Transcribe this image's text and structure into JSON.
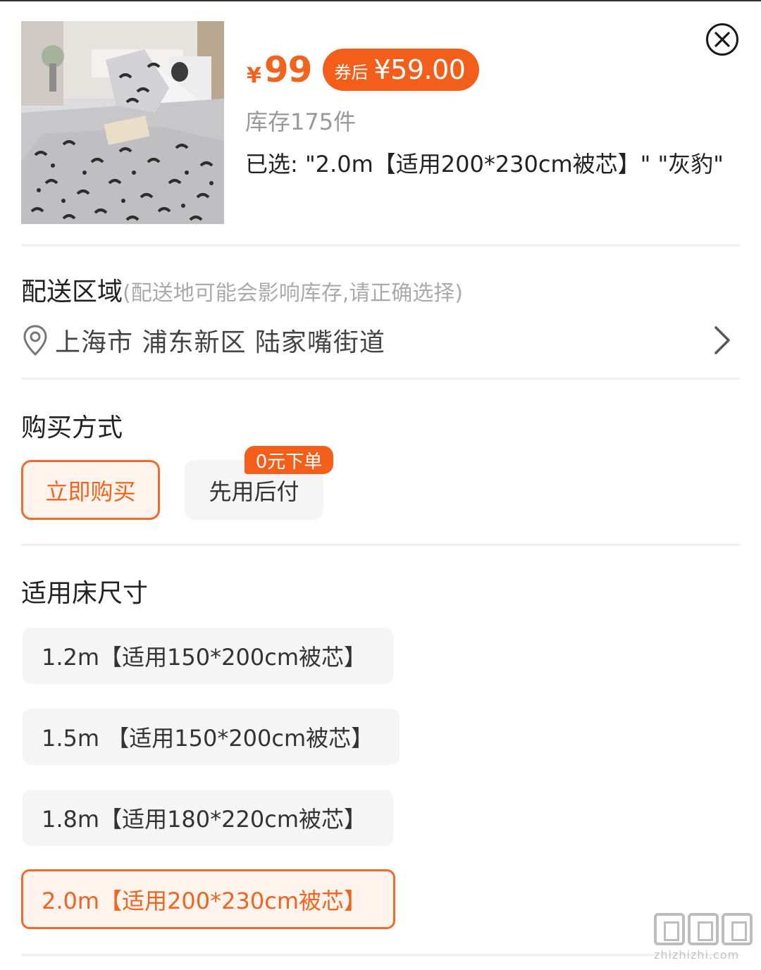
{
  "product": {
    "image_icon": "bedding-leopard-print-photo",
    "currency_symbol": "¥",
    "price": "99",
    "coupon_label": "券后",
    "coupon_price": "¥59.00",
    "stock": "库存175件",
    "selected_text": "已选: \"2.0m【适用200*230cm被芯】\" \"灰豹\""
  },
  "close_icon": "close-circle-icon",
  "delivery": {
    "title": "配送区域",
    "hint": "(配送地可能会影响库存,请正确选择)",
    "address": "上海市 浦东新区 陆家嘴街道"
  },
  "purchase": {
    "title": "购买方式",
    "buy_now": "立即购买",
    "pay_later": "先用后付",
    "pay_later_badge": "0元下单"
  },
  "sizes": {
    "title": "适用床尺寸",
    "options": [
      {
        "label": "1.2m【适用150*200cm被芯】",
        "selected": false
      },
      {
        "label": "1.5m 【适用150*200cm被芯】",
        "selected": false
      },
      {
        "label": "1.8m【适用180*220cm被芯】",
        "selected": false
      },
      {
        "label": "2.0m【适用200*230cm被芯】",
        "selected": true
      }
    ]
  },
  "watermark": {
    "text": "zhizhizhi.com"
  },
  "colors": {
    "accent": "#f0641e",
    "accent_bg": "#fff3ee",
    "option_bg": "#f5f5f5"
  }
}
